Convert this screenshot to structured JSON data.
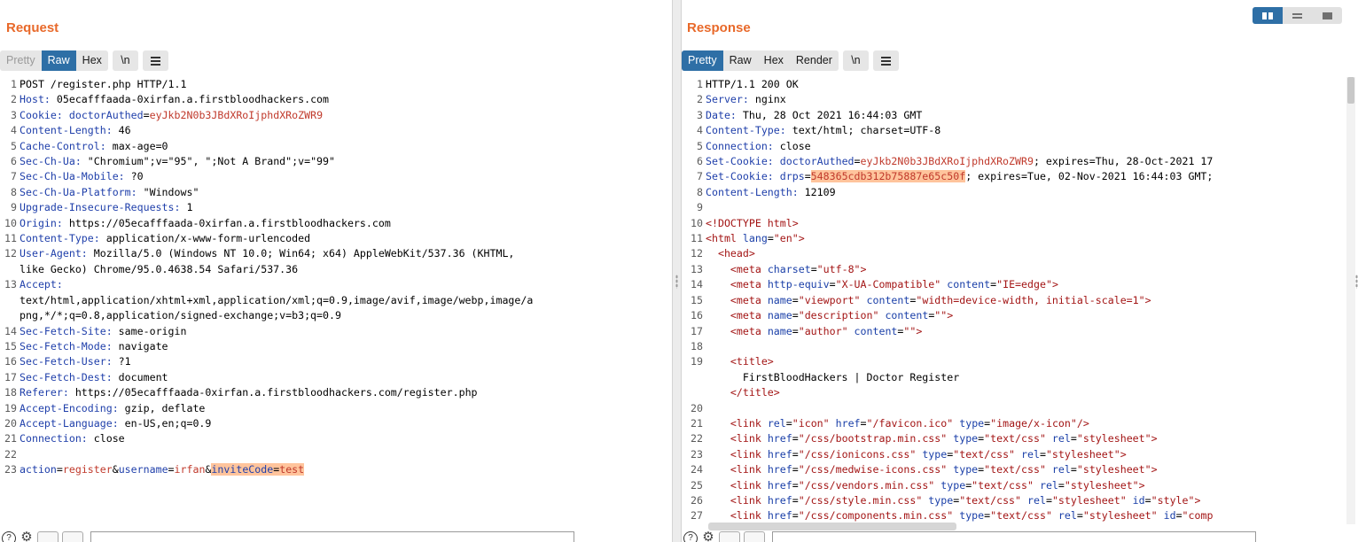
{
  "request": {
    "title": "Request",
    "tabs": [
      "Pretty",
      "Raw",
      "Hex"
    ],
    "newline_btn": "\\n",
    "lines": [
      [
        [
          "pl",
          "POST /register.php HTTP/1.1"
        ]
      ],
      [
        [
          "hk",
          "Host:"
        ],
        [
          "hv",
          " 05ecafffaada-0xirfan.a.firstbloodhackers.com"
        ]
      ],
      [
        [
          "hk",
          "Cookie:"
        ],
        [
          "hv",
          " "
        ],
        [
          "cn",
          "doctorAuthed"
        ],
        [
          "hv",
          "="
        ],
        [
          "cv",
          "eyJkb2N0b3JBdXRoIjphdXRoZWR9"
        ]
      ],
      [
        [
          "hk",
          "Content-Length:"
        ],
        [
          "hv",
          " 46"
        ]
      ],
      [
        [
          "hk",
          "Cache-Control:"
        ],
        [
          "hv",
          " max-age=0"
        ]
      ],
      [
        [
          "hk",
          "Sec-Ch-Ua:"
        ],
        [
          "hv",
          " \"Chromium\";v=\"95\", \";Not A Brand\";v=\"99\""
        ]
      ],
      [
        [
          "hk",
          "Sec-Ch-Ua-Mobile:"
        ],
        [
          "hv",
          " ?0"
        ]
      ],
      [
        [
          "hk",
          "Sec-Ch-Ua-Platform:"
        ],
        [
          "hv",
          " \"Windows\""
        ]
      ],
      [
        [
          "hk",
          "Upgrade-Insecure-Requests:"
        ],
        [
          "hv",
          " 1"
        ]
      ],
      [
        [
          "hk",
          "Origin:"
        ],
        [
          "hv",
          " https://05ecafffaada-0xirfan.a.firstbloodhackers.com"
        ]
      ],
      [
        [
          "hk",
          "Content-Type:"
        ],
        [
          "hv",
          " application/x-www-form-urlencoded"
        ]
      ],
      [
        [
          "hk",
          "User-Agent:"
        ],
        [
          "hv",
          " Mozilla/5.0 (Windows NT 10.0; Win64; x64) AppleWebKit/537.36 (KHTML,"
        ]
      ],
      [
        [
          "hv",
          "like Gecko) Chrome/95.0.4638.54 Safari/537.36"
        ]
      ],
      [
        [
          "hk",
          "Accept:"
        ]
      ],
      [
        [
          "hv",
          "text/html,application/xhtml+xml,application/xml;q=0.9,image/avif,image/webp,image/a"
        ]
      ],
      [
        [
          "hv",
          "png,*/*;q=0.8,application/signed-exchange;v=b3;q=0.9"
        ]
      ],
      [
        [
          "hk",
          "Sec-Fetch-Site:"
        ],
        [
          "hv",
          " same-origin"
        ]
      ],
      [
        [
          "hk",
          "Sec-Fetch-Mode:"
        ],
        [
          "hv",
          " navigate"
        ]
      ],
      [
        [
          "hk",
          "Sec-Fetch-User:"
        ],
        [
          "hv",
          " ?1"
        ]
      ],
      [
        [
          "hk",
          "Sec-Fetch-Dest:"
        ],
        [
          "hv",
          " document"
        ]
      ],
      [
        [
          "hk",
          "Referer:"
        ],
        [
          "hv",
          " https://05ecafffaada-0xirfan.a.firstbloodhackers.com/register.php"
        ]
      ],
      [
        [
          "hk",
          "Accept-Encoding:"
        ],
        [
          "hv",
          " gzip, deflate"
        ]
      ],
      [
        [
          "hk",
          "Accept-Language:"
        ],
        [
          "hv",
          " en-US,en;q=0.9"
        ]
      ],
      [
        [
          "hk",
          "Connection:"
        ],
        [
          "hv",
          " close"
        ]
      ],
      [],
      [
        [
          "cn",
          "action"
        ],
        [
          "pl",
          "="
        ],
        [
          "cv",
          "register"
        ],
        [
          "pl",
          "&"
        ],
        [
          "cn",
          "username"
        ],
        [
          "pl",
          "="
        ],
        [
          "cv",
          "irfan"
        ],
        [
          "pl",
          "&"
        ],
        [
          "cn hl",
          "inviteCode"
        ],
        [
          "pl hl",
          "="
        ],
        [
          "cv hl",
          "test"
        ]
      ]
    ],
    "line_numbers": [
      "1",
      "2",
      "3",
      "4",
      "5",
      "6",
      "7",
      "8",
      "9",
      "10",
      "11",
      "12",
      "",
      "13",
      "",
      "",
      "14",
      "15",
      "16",
      "17",
      "18",
      "19",
      "20",
      "21",
      "22",
      "23"
    ]
  },
  "response": {
    "title": "Response",
    "tabs": [
      "Pretty",
      "Raw",
      "Hex",
      "Render"
    ],
    "newline_btn": "\\n",
    "lines": [
      [
        [
          "pl",
          "HTTP/1.1 200 OK"
        ]
      ],
      [
        [
          "hk",
          "Server:"
        ],
        [
          "hv",
          " nginx"
        ]
      ],
      [
        [
          "hk",
          "Date:"
        ],
        [
          "hv",
          " Thu, 28 Oct 2021 16:44:03 GMT"
        ]
      ],
      [
        [
          "hk",
          "Content-Type:"
        ],
        [
          "hv",
          " text/html; charset=UTF-8"
        ]
      ],
      [
        [
          "hk",
          "Connection:"
        ],
        [
          "hv",
          " close"
        ]
      ],
      [
        [
          "hk",
          "Set-Cookie:"
        ],
        [
          "hv",
          " "
        ],
        [
          "cn",
          "doctorAuthed"
        ],
        [
          "hv",
          "="
        ],
        [
          "cv",
          "eyJkb2N0b3JBdXRoIjphdXRoZWR9"
        ],
        [
          "hv",
          "; expires=Thu, 28-Oct-2021 17"
        ]
      ],
      [
        [
          "hk",
          "Set-Cookie:"
        ],
        [
          "hv",
          " "
        ],
        [
          "cn",
          "drps"
        ],
        [
          "hv",
          "="
        ],
        [
          "cv hl",
          "548365cdb312b75887e65c50f"
        ],
        [
          "hv",
          "; expires=Tue, 02-Nov-2021 16:44:03 GMT;"
        ]
      ],
      [
        [
          "hk",
          "Content-Length:"
        ],
        [
          "hv",
          " 12109"
        ]
      ],
      [],
      [
        [
          "tag",
          "<!DOCTYPE html>"
        ]
      ],
      [
        [
          "tag",
          "<html "
        ],
        [
          "attr",
          "lang"
        ],
        [
          "pl",
          "="
        ],
        [
          "str",
          "\"en\""
        ],
        [
          "tag",
          ">"
        ]
      ],
      [
        [
          "pl",
          "  "
        ],
        [
          "tag",
          "<head>"
        ]
      ],
      [
        [
          "pl",
          "    "
        ],
        [
          "tag",
          "<meta "
        ],
        [
          "attr",
          "charset"
        ],
        [
          "pl",
          "="
        ],
        [
          "str",
          "\"utf-8\""
        ],
        [
          "tag",
          ">"
        ]
      ],
      [
        [
          "pl",
          "    "
        ],
        [
          "tag",
          "<meta "
        ],
        [
          "attr",
          "http-equiv"
        ],
        [
          "pl",
          "="
        ],
        [
          "str",
          "\"X-UA-Compatible\""
        ],
        [
          "attr",
          " content"
        ],
        [
          "pl",
          "="
        ],
        [
          "str",
          "\"IE=edge\""
        ],
        [
          "tag",
          ">"
        ]
      ],
      [
        [
          "pl",
          "    "
        ],
        [
          "tag",
          "<meta "
        ],
        [
          "attr",
          "name"
        ],
        [
          "pl",
          "="
        ],
        [
          "str",
          "\"viewport\""
        ],
        [
          "attr",
          " content"
        ],
        [
          "pl",
          "="
        ],
        [
          "str",
          "\"width=device-width, initial-scale=1\""
        ],
        [
          "tag",
          ">"
        ]
      ],
      [
        [
          "pl",
          "    "
        ],
        [
          "tag",
          "<meta "
        ],
        [
          "attr",
          "name"
        ],
        [
          "pl",
          "="
        ],
        [
          "str",
          "\"description\""
        ],
        [
          "attr",
          " content"
        ],
        [
          "pl",
          "="
        ],
        [
          "str",
          "\"\""
        ],
        [
          "tag",
          ">"
        ]
      ],
      [
        [
          "pl",
          "    "
        ],
        [
          "tag",
          "<meta "
        ],
        [
          "attr",
          "name"
        ],
        [
          "pl",
          "="
        ],
        [
          "str",
          "\"author\""
        ],
        [
          "attr",
          " content"
        ],
        [
          "pl",
          "="
        ],
        [
          "str",
          "\"\""
        ],
        [
          "tag",
          ">"
        ]
      ],
      [],
      [
        [
          "pl",
          "    "
        ],
        [
          "tag",
          "<title>"
        ]
      ],
      [
        [
          "pl",
          "      FirstBloodHackers | Doctor Register"
        ]
      ],
      [
        [
          "pl",
          "    "
        ],
        [
          "tag",
          "</title>"
        ]
      ],
      [],
      [
        [
          "pl",
          "    "
        ],
        [
          "tag",
          "<link "
        ],
        [
          "attr",
          "rel"
        ],
        [
          "pl",
          "="
        ],
        [
          "str",
          "\"icon\""
        ],
        [
          "attr",
          " href"
        ],
        [
          "pl",
          "="
        ],
        [
          "str",
          "\"/favicon.ico\""
        ],
        [
          "attr",
          " type"
        ],
        [
          "pl",
          "="
        ],
        [
          "str",
          "\"image/x-icon\""
        ],
        [
          "tag",
          "/>"
        ]
      ],
      [
        [
          "pl",
          "    "
        ],
        [
          "tag",
          "<link "
        ],
        [
          "attr",
          "href"
        ],
        [
          "pl",
          "="
        ],
        [
          "str",
          "\"/css/bootstrap.min.css\""
        ],
        [
          "attr",
          " type"
        ],
        [
          "pl",
          "="
        ],
        [
          "str",
          "\"text/css\""
        ],
        [
          "attr",
          " rel"
        ],
        [
          "pl",
          "="
        ],
        [
          "str",
          "\"stylesheet\""
        ],
        [
          "tag",
          ">"
        ]
      ],
      [
        [
          "pl",
          "    "
        ],
        [
          "tag",
          "<link "
        ],
        [
          "attr",
          "href"
        ],
        [
          "pl",
          "="
        ],
        [
          "str",
          "\"/css/ionicons.css\""
        ],
        [
          "attr",
          " type"
        ],
        [
          "pl",
          "="
        ],
        [
          "str",
          "\"text/css\""
        ],
        [
          "attr",
          " rel"
        ],
        [
          "pl",
          "="
        ],
        [
          "str",
          "\"stylesheet\""
        ],
        [
          "tag",
          ">"
        ]
      ],
      [
        [
          "pl",
          "    "
        ],
        [
          "tag",
          "<link "
        ],
        [
          "attr",
          "href"
        ],
        [
          "pl",
          "="
        ],
        [
          "str",
          "\"/css/medwise-icons.css\""
        ],
        [
          "attr",
          " type"
        ],
        [
          "pl",
          "="
        ],
        [
          "str",
          "\"text/css\""
        ],
        [
          "attr",
          " rel"
        ],
        [
          "pl",
          "="
        ],
        [
          "str",
          "\"stylesheet\""
        ],
        [
          "tag",
          ">"
        ]
      ],
      [
        [
          "pl",
          "    "
        ],
        [
          "tag",
          "<link "
        ],
        [
          "attr",
          "href"
        ],
        [
          "pl",
          "="
        ],
        [
          "str",
          "\"/css/vendors.min.css\""
        ],
        [
          "attr",
          " type"
        ],
        [
          "pl",
          "="
        ],
        [
          "str",
          "\"text/css\""
        ],
        [
          "attr",
          " rel"
        ],
        [
          "pl",
          "="
        ],
        [
          "str",
          "\"stylesheet\""
        ],
        [
          "tag",
          ">"
        ]
      ],
      [
        [
          "pl",
          "    "
        ],
        [
          "tag",
          "<link "
        ],
        [
          "attr",
          "href"
        ],
        [
          "pl",
          "="
        ],
        [
          "str",
          "\"/css/style.min.css\""
        ],
        [
          "attr",
          " type"
        ],
        [
          "pl",
          "="
        ],
        [
          "str",
          "\"text/css\""
        ],
        [
          "attr",
          " rel"
        ],
        [
          "pl",
          "="
        ],
        [
          "str",
          "\"stylesheet\""
        ],
        [
          "attr",
          " id"
        ],
        [
          "pl",
          "="
        ],
        [
          "str",
          "\"style\""
        ],
        [
          "tag",
          ">"
        ]
      ],
      [
        [
          "pl",
          "    "
        ],
        [
          "tag",
          "<link "
        ],
        [
          "attr",
          "href"
        ],
        [
          "pl",
          "="
        ],
        [
          "str",
          "\"/css/components.min.css\""
        ],
        [
          "attr",
          " type"
        ],
        [
          "pl",
          "="
        ],
        [
          "str",
          "\"text/css\""
        ],
        [
          "attr",
          " rel"
        ],
        [
          "pl",
          "="
        ],
        [
          "str",
          "\"stylesheet\""
        ],
        [
          "attr",
          " id"
        ],
        [
          "pl",
          "="
        ],
        [
          "str",
          "\"comp"
        ]
      ]
    ],
    "line_numbers": [
      "1",
      "2",
      "3",
      "4",
      "5",
      "6",
      "7",
      "8",
      "9",
      "10",
      "11",
      "12",
      "13",
      "14",
      "15",
      "16",
      "17",
      "18",
      "19",
      "",
      "",
      "20",
      "21",
      "22",
      "23",
      "24",
      "25",
      "26",
      "27"
    ]
  },
  "colors": {
    "accent": "#e8692a",
    "selected_tab": "#2e6fa6",
    "highlight": "#ffc49c"
  },
  "icons": {
    "layout_toggle": [
      "columns-icon",
      "rows-icon",
      "single-pane-icon"
    ],
    "bottom": [
      "help-icon",
      "settings-gear-icon"
    ]
  }
}
